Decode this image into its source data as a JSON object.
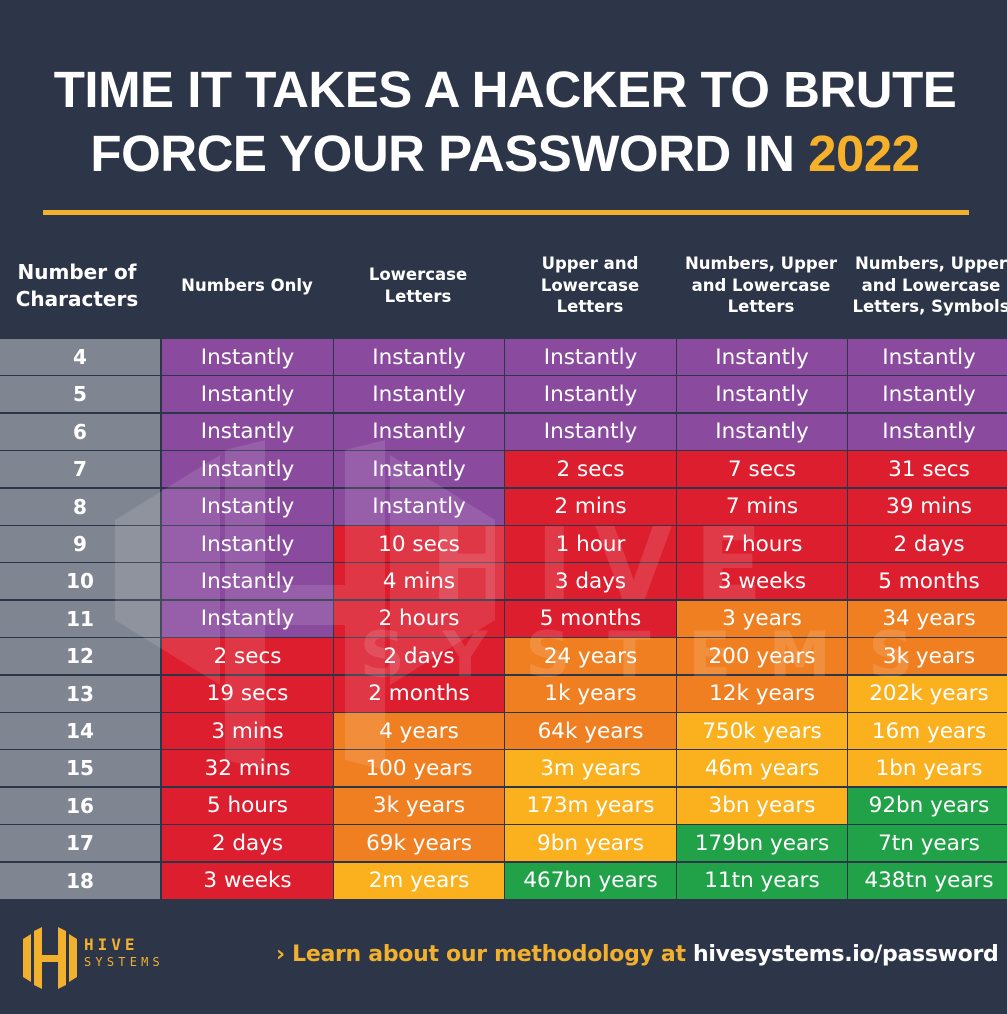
{
  "title": {
    "line1": "TIME IT TAKES A HACKER TO BRUTE",
    "line2_prefix": "FORCE YOUR PASSWORD IN ",
    "year": "2022"
  },
  "colors": {
    "background": "#2d3548",
    "accent": "#f1b02d",
    "row_header": "#808691",
    "purple": "#8a4b9f",
    "red": "#dc1e2f",
    "orange": "#f07f22",
    "yellow": "#fbb01e",
    "green": "#21a249"
  },
  "chart_data": {
    "type": "table",
    "title": "TIME IT TAKES A HACKER TO BRUTE FORCE YOUR PASSWORD IN 2022",
    "row_header_label": "Number of Characters",
    "columns": [
      "Numbers Only",
      "Lowercase Letters",
      "Upper and Lowercase Letters",
      "Numbers, Upper and Lowercase Letters",
      "Numbers, Upper and Lowercase Letters, Symbols"
    ],
    "column_header_lines": [
      [
        "Number of",
        "Characters"
      ],
      [
        "Numbers Only"
      ],
      [
        "Lowercase",
        "Letters"
      ],
      [
        "Upper and",
        "Lowercase",
        "Letters"
      ],
      [
        "Numbers, Upper",
        "and Lowercase",
        "Letters"
      ],
      [
        "Numbers, Upper",
        "and Lowercase",
        "Letters, Symbols"
      ]
    ],
    "rows": [
      {
        "chars": "4",
        "values": [
          "Instantly",
          "Instantly",
          "Instantly",
          "Instantly",
          "Instantly"
        ],
        "levels": [
          "purple",
          "purple",
          "purple",
          "purple",
          "purple"
        ]
      },
      {
        "chars": "5",
        "values": [
          "Instantly",
          "Instantly",
          "Instantly",
          "Instantly",
          "Instantly"
        ],
        "levels": [
          "purple",
          "purple",
          "purple",
          "purple",
          "purple"
        ]
      },
      {
        "chars": "6",
        "values": [
          "Instantly",
          "Instantly",
          "Instantly",
          "Instantly",
          "Instantly"
        ],
        "levels": [
          "purple",
          "purple",
          "purple",
          "purple",
          "purple"
        ]
      },
      {
        "chars": "7",
        "values": [
          "Instantly",
          "Instantly",
          "2 secs",
          "7 secs",
          "31 secs"
        ],
        "levels": [
          "purple",
          "purple",
          "red",
          "red",
          "red"
        ]
      },
      {
        "chars": "8",
        "values": [
          "Instantly",
          "Instantly",
          "2 mins",
          "7 mins",
          "39 mins"
        ],
        "levels": [
          "purple",
          "purple",
          "red",
          "red",
          "red"
        ]
      },
      {
        "chars": "9",
        "values": [
          "Instantly",
          "10 secs",
          "1 hour",
          "7 hours",
          "2 days"
        ],
        "levels": [
          "purple",
          "red",
          "red",
          "red",
          "red"
        ]
      },
      {
        "chars": "10",
        "values": [
          "Instantly",
          "4 mins",
          "3 days",
          "3 weeks",
          "5 months"
        ],
        "levels": [
          "purple",
          "red",
          "red",
          "red",
          "red"
        ]
      },
      {
        "chars": "11",
        "values": [
          "Instantly",
          "2 hours",
          "5 months",
          "3 years",
          "34 years"
        ],
        "levels": [
          "purple",
          "red",
          "red",
          "orange",
          "orange"
        ]
      },
      {
        "chars": "12",
        "values": [
          "2 secs",
          "2 days",
          "24 years",
          "200 years",
          "3k years"
        ],
        "levels": [
          "red",
          "red",
          "orange",
          "orange",
          "orange"
        ]
      },
      {
        "chars": "13",
        "values": [
          "19 secs",
          "2 months",
          "1k years",
          "12k years",
          "202k years"
        ],
        "levels": [
          "red",
          "red",
          "orange",
          "orange",
          "yellow"
        ]
      },
      {
        "chars": "14",
        "values": [
          "3 mins",
          "4 years",
          "64k years",
          "750k years",
          "16m years"
        ],
        "levels": [
          "red",
          "orange",
          "orange",
          "yellow",
          "yellow"
        ]
      },
      {
        "chars": "15",
        "values": [
          "32 mins",
          "100 years",
          "3m years",
          "46m years",
          "1bn years"
        ],
        "levels": [
          "red",
          "orange",
          "yellow",
          "yellow",
          "yellow"
        ]
      },
      {
        "chars": "16",
        "values": [
          "5 hours",
          "3k years",
          "173m years",
          "3bn years",
          "92bn years"
        ],
        "levels": [
          "red",
          "orange",
          "yellow",
          "yellow",
          "green"
        ]
      },
      {
        "chars": "17",
        "values": [
          "2 days",
          "69k years",
          "9bn years",
          "179bn years",
          "7tn years"
        ],
        "levels": [
          "red",
          "orange",
          "yellow",
          "green",
          "green"
        ]
      },
      {
        "chars": "18",
        "values": [
          "3 weeks",
          "2m years",
          "467bn years",
          "11tn years",
          "438tn years"
        ],
        "levels": [
          "red",
          "yellow",
          "green",
          "green",
          "green"
        ]
      }
    ]
  },
  "footer": {
    "logo_line1": "HIVE",
    "logo_line2": "SYSTEMS",
    "link_prefix": "› Learn about our methodology at ",
    "link_url": "hivesystems.io/password"
  },
  "watermark": {
    "text_line1": "HIVE",
    "text_line2": "SYSTEMS"
  }
}
